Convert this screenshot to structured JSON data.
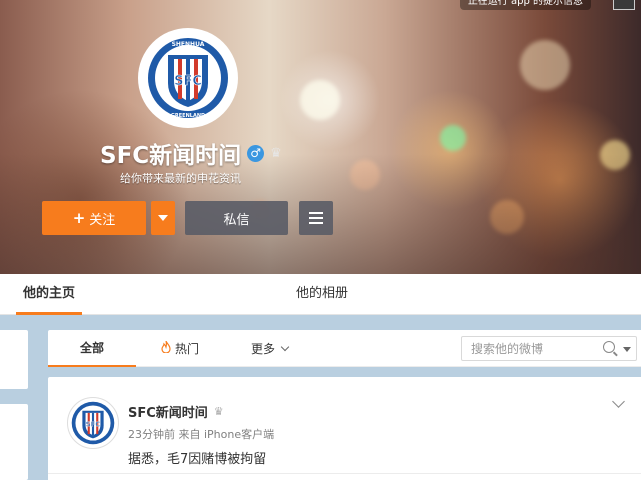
{
  "header": {
    "top_badge": "正在运行 app 的提示信息",
    "profile_name": "SFC新闻时间",
    "gender_symbol": "♂",
    "crown_symbol": "♛",
    "bio": "给你带来最新的申花资讯",
    "follow_label": "关注",
    "follow_plus": "+",
    "message_label": "私信"
  },
  "logo": {
    "top_text": "SHENHUA",
    "letters": "SFC",
    "bottom_text": "GREENLAND"
  },
  "tabs": {
    "home": "他的主页",
    "album": "他的相册"
  },
  "filter": {
    "all": "全部",
    "hot": "热门",
    "more": "更多",
    "search_placeholder": "搜索他的微博"
  },
  "post": {
    "author": "SFC新闻时间",
    "meta": "23分钟前 来自 iPhone客户端",
    "text": "据悉，毛7因赌博被拘留"
  },
  "colors": {
    "accent": "#f77c1d",
    "page_bg": "#b9cfe0",
    "logo_blue": "#1f5aa8",
    "logo_red": "#d23a2b"
  }
}
